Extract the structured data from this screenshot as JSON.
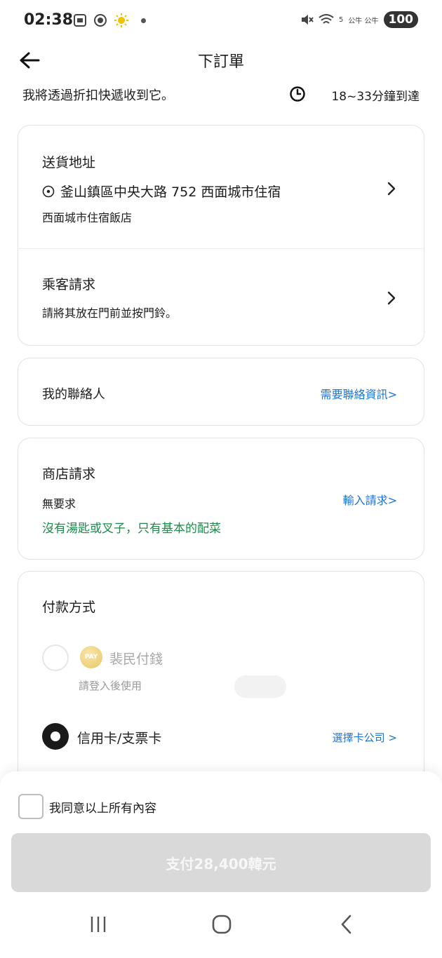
{
  "status_bar": {
    "time": "02:38",
    "carrier_text": "公牛 公牛",
    "battery": "100",
    "network": "5"
  },
  "header": {
    "title": "下訂單"
  },
  "delivery": {
    "note": "我將透過折扣快遞收到它。",
    "eta": "18~33分鐘到達"
  },
  "address_card": {
    "title": "送貨地址",
    "address": "釜山鎮區中央大路 752 西面城市住宿",
    "place_name": "西面城市住宿飯店",
    "request_title": "乘客請求",
    "request_value": "請將其放在門前並按門鈴。"
  },
  "contact_card": {
    "title": "我的聯絡人",
    "link": "需要聯絡資訊>"
  },
  "store_card": {
    "title": "商店請求",
    "value": "無要求",
    "link": "輸入請求>",
    "note": "沒有湯匙或叉子，只有基本的配菜"
  },
  "payment_card": {
    "title": "付款方式",
    "option1_name": "裴民付錢",
    "option1_coin": "PAY",
    "option1_sub": "請登入後使用",
    "option2_name": "信用卡/支票卡",
    "option2_link": "選擇卡公司 >"
  },
  "bottom_sheet": {
    "agree_label": "我同意以上所有內容",
    "pay_button": "支付28,400韓元"
  },
  "colors": {
    "link_blue": "#1a73d9",
    "note_green": "#1c8a4a",
    "button_disabled": "#d9d9d9"
  }
}
